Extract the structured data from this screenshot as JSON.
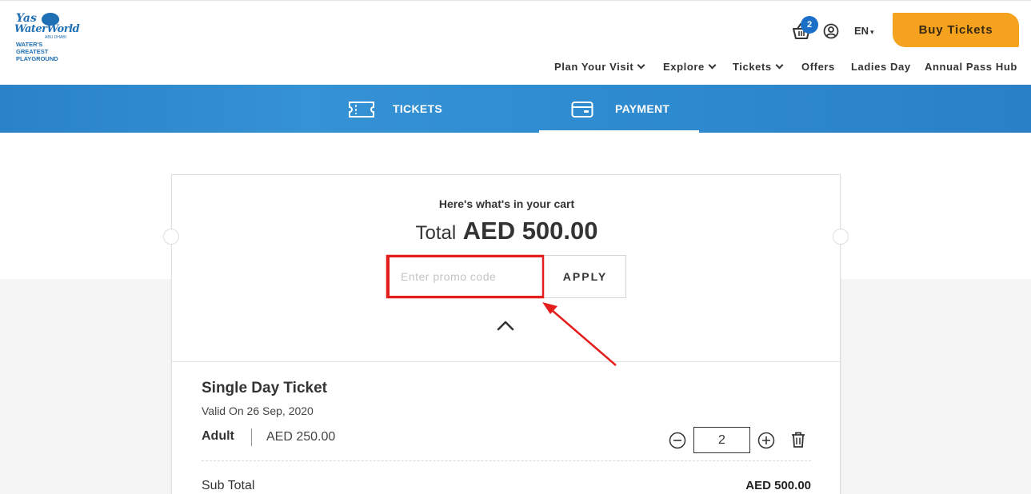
{
  "brand": {
    "logo_line1": "Yas",
    "logo_line2": "WaterWorld",
    "logo_city": "ABU DHABI",
    "logo_tagline1": "WATER'S GREATEST",
    "logo_tagline2": "PLAYGROUND",
    "logo_color": "#1f6fb4"
  },
  "header": {
    "cart_count": "2",
    "language": "EN",
    "buy_label": "Buy Tickets",
    "buy_color": "#f5a31f",
    "nav": [
      {
        "label": "Plan Your Visit",
        "dropdown": true
      },
      {
        "label": "Explore",
        "dropdown": true
      },
      {
        "label": "Tickets",
        "dropdown": true
      },
      {
        "label": "Offers",
        "dropdown": false
      },
      {
        "label": "Ladies Day",
        "dropdown": false
      },
      {
        "label": "Annual Pass Hub",
        "dropdown": false
      }
    ]
  },
  "steps": {
    "tickets_label": "TICKETS",
    "payment_label": "PAYMENT",
    "active": "PAYMENT",
    "band_color": "#2f8bd0"
  },
  "cart": {
    "heading": "Here's what's in your cart",
    "total_label": "Total",
    "total_amount": "AED 500.00",
    "promo_placeholder": "Enter promo code",
    "promo_value": "",
    "apply_label": "APPLY",
    "collapse_icon": "chevron-up-icon",
    "ticket": {
      "name": "Single Day Ticket",
      "valid_on": "Valid On 26 Sep, 2020",
      "type": "Adult",
      "price": "AED 250.00",
      "quantity": "2"
    },
    "subtotal_label": "Sub Total",
    "subtotal_value": "AED 500.00"
  },
  "annotation": {
    "highlight_color": "#e41d1d"
  }
}
